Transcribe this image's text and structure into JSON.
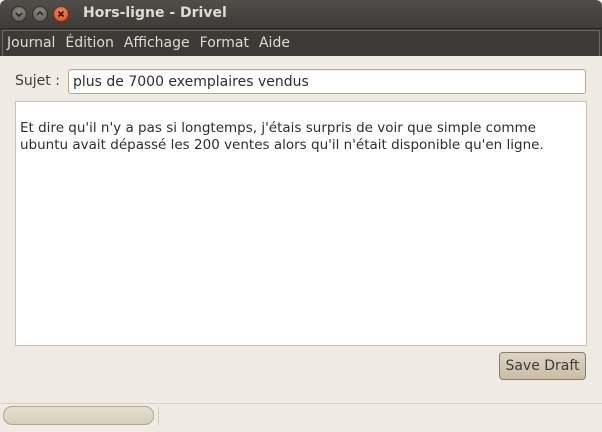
{
  "window": {
    "title": "Hors-ligne - Drivel"
  },
  "menu": {
    "items": [
      "Journal",
      "Édition",
      "Affichage",
      "Format",
      "Aide"
    ]
  },
  "subject": {
    "label": "Sujet :",
    "value": "plus de 7000 exemplaires vendus"
  },
  "body": {
    "text": "Et dire qu'il n'y a pas si longtemps, j'étais surpris de voir que simple comme ubuntu avait dépassé les 200 ventes alors qu'il n'était disponible qu'en ligne."
  },
  "actions": {
    "save_label": "Save Draft"
  },
  "colors": {
    "titlebar": "#3d3c38",
    "close_button": "#dd4814",
    "window_bg": "#f0ebe2"
  },
  "icons": {
    "minimize": "minimize-icon",
    "maximize": "maximize-icon",
    "close": "close-icon"
  }
}
